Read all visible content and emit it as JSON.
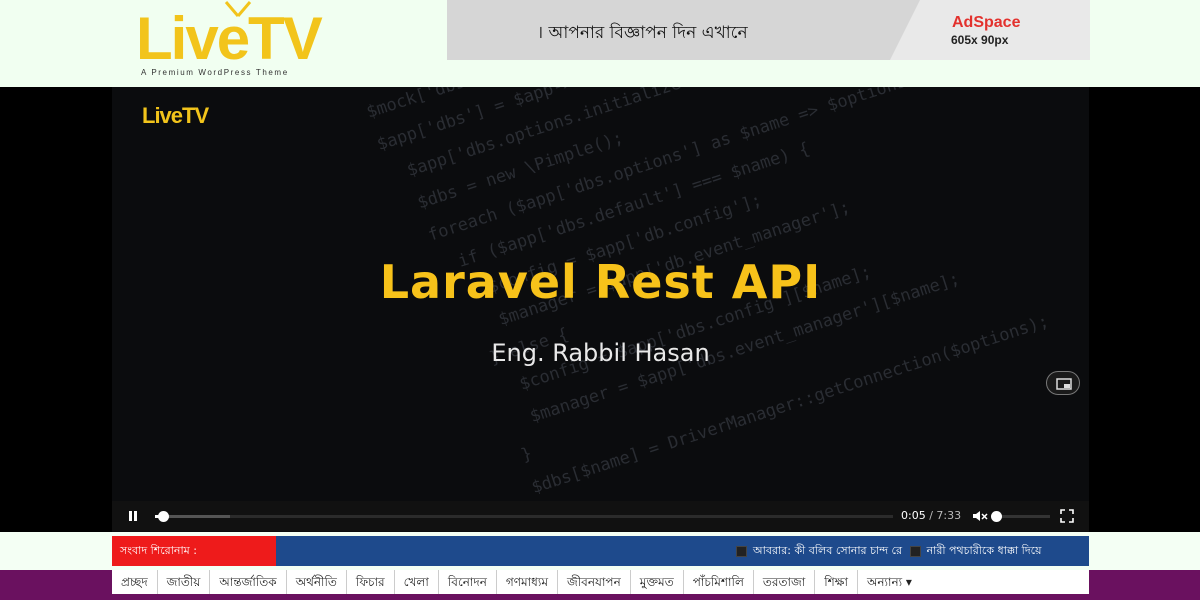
{
  "header": {
    "logo_text": "LiveTV",
    "logo_tagline": "A Premium WordPress Theme",
    "ad": {
      "text": "। আপনার বিজ্ঞাপন দিন এখানে",
      "title": "AdSpace",
      "size": "605x 90px"
    }
  },
  "video": {
    "watermark": "LiveTV",
    "title": "Laravel Rest API",
    "author": "Eng. Rabbil Hasan",
    "current_time": "0:05",
    "duration": "7:33",
    "progress_fraction": 0.011,
    "volume_fraction": 0.0,
    "code_lines": [
      "$mock['dbs.options'] = $tmp;",
      "$app['dbs'] = $app->share(function ($app) {",
      "  $app['dbs.options.initializer']();",
      "  $dbs = new \\Pimple();",
      "  foreach ($app['dbs.options'] as $name => $options) {",
      "    if ($app['dbs.default'] === $name) {",
      "      $config = $app['db.config'];",
      "      $manager = $app['db.event_manager'];",
      "    } else {",
      "      $config = $app['dbs.config'][$name];",
      "      $manager = $app['dbs.event_manager'][$name];",
      "    }",
      "    $dbs[$name] = DriverManager::getConnection($options);"
    ]
  },
  "ticker": {
    "label": "সংবাদ শিরোনাম :",
    "items": [
      "আবরার: কী বলিব সোনার চান্দ রে",
      "নারী পথচারীকে ধাক্কা দিয়ে"
    ]
  },
  "nav": {
    "items": [
      "প্রচ্ছদ",
      "জাতীয়",
      "আন্তর্জাতিক",
      "অর্থনীতি",
      "ফিচার",
      "খেলা",
      "বিনোদন",
      "গণমাধ্যম",
      "জীবনযাপন",
      "মুক্তমত",
      "পাঁচমিশালি",
      "তরতাজা",
      "শিক্ষা",
      "অন্যান্য"
    ]
  },
  "colors": {
    "brand_yellow": "#f2c41b",
    "ticker_red": "#ee1b1b",
    "ticker_blue": "#1e4a8c",
    "nav_purple": "#6a115f"
  }
}
